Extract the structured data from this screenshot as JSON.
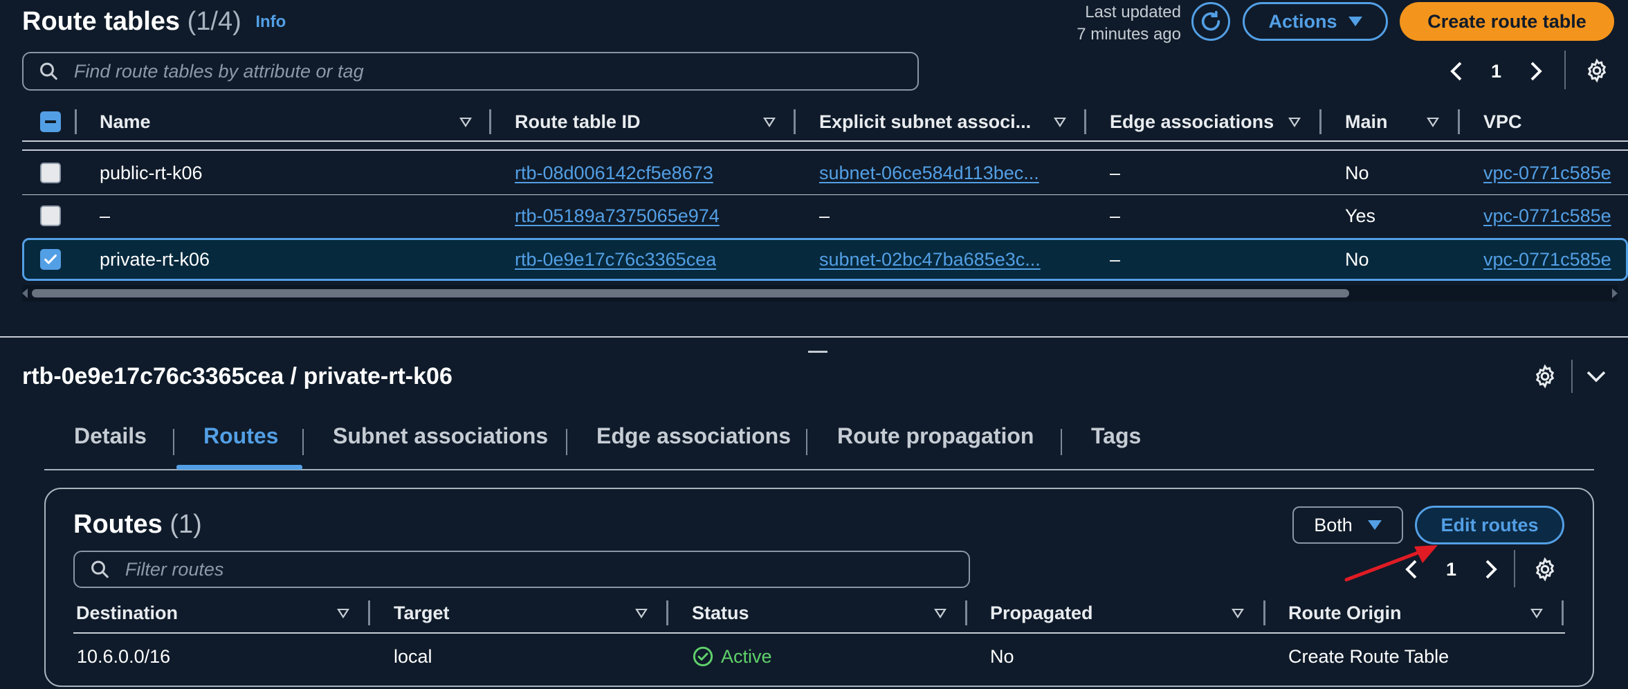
{
  "header": {
    "title": "Route tables",
    "count": "(1/4)",
    "info": "Info",
    "last_updated_line1": "Last updated",
    "last_updated_line2": "7 minutes ago",
    "actions_label": "Actions",
    "create_label": "Create route table"
  },
  "search": {
    "placeholder": "Find route tables by attribute or tag"
  },
  "pagination": {
    "page": "1"
  },
  "table": {
    "columns": [
      "Name",
      "Route table ID",
      "Explicit subnet associ...",
      "Edge associations",
      "Main",
      "VPC"
    ],
    "rows": [
      {
        "name": "public-rt-k06",
        "id": "rtb-08d006142cf5e8673",
        "subnet": "subnet-06ce584d113bec...",
        "edge": "–",
        "main": "No",
        "vpc": "vpc-0771c585e",
        "selected": false
      },
      {
        "name": "–",
        "id": "rtb-05189a7375065e974",
        "subnet": "–",
        "edge": "–",
        "main": "Yes",
        "vpc": "vpc-0771c585e",
        "selected": false
      },
      {
        "name": "private-rt-k06",
        "id": "rtb-0e9e17c76c3365cea",
        "subnet": "subnet-02bc47ba685e3c...",
        "edge": "–",
        "main": "No",
        "vpc": "vpc-0771c585e",
        "selected": true
      }
    ]
  },
  "detail": {
    "title": "rtb-0e9e17c76c3365cea / private-rt-k06",
    "tabs": [
      "Details",
      "Routes",
      "Subnet associations",
      "Edge associations",
      "Route propagation",
      "Tags"
    ],
    "active_tab": "Routes",
    "routes": {
      "title": "Routes",
      "count": "(1)",
      "filter_value": "Both",
      "edit_label": "Edit routes",
      "search_placeholder": "Filter routes",
      "page": "1",
      "columns": [
        "Destination",
        "Target",
        "Status",
        "Propagated",
        "Route Origin"
      ],
      "rows": [
        {
          "destination": "10.6.0.0/16",
          "target": "local",
          "status": "Active",
          "propagated": "No",
          "origin": "Create Route Table"
        }
      ]
    }
  },
  "colors": {
    "background": "#0f1b2a",
    "link": "#539fe5",
    "primary": "#f3941c",
    "selected_row": "#06293d",
    "status_active": "#29ad32",
    "annotation_arrow": "#e01b24"
  }
}
